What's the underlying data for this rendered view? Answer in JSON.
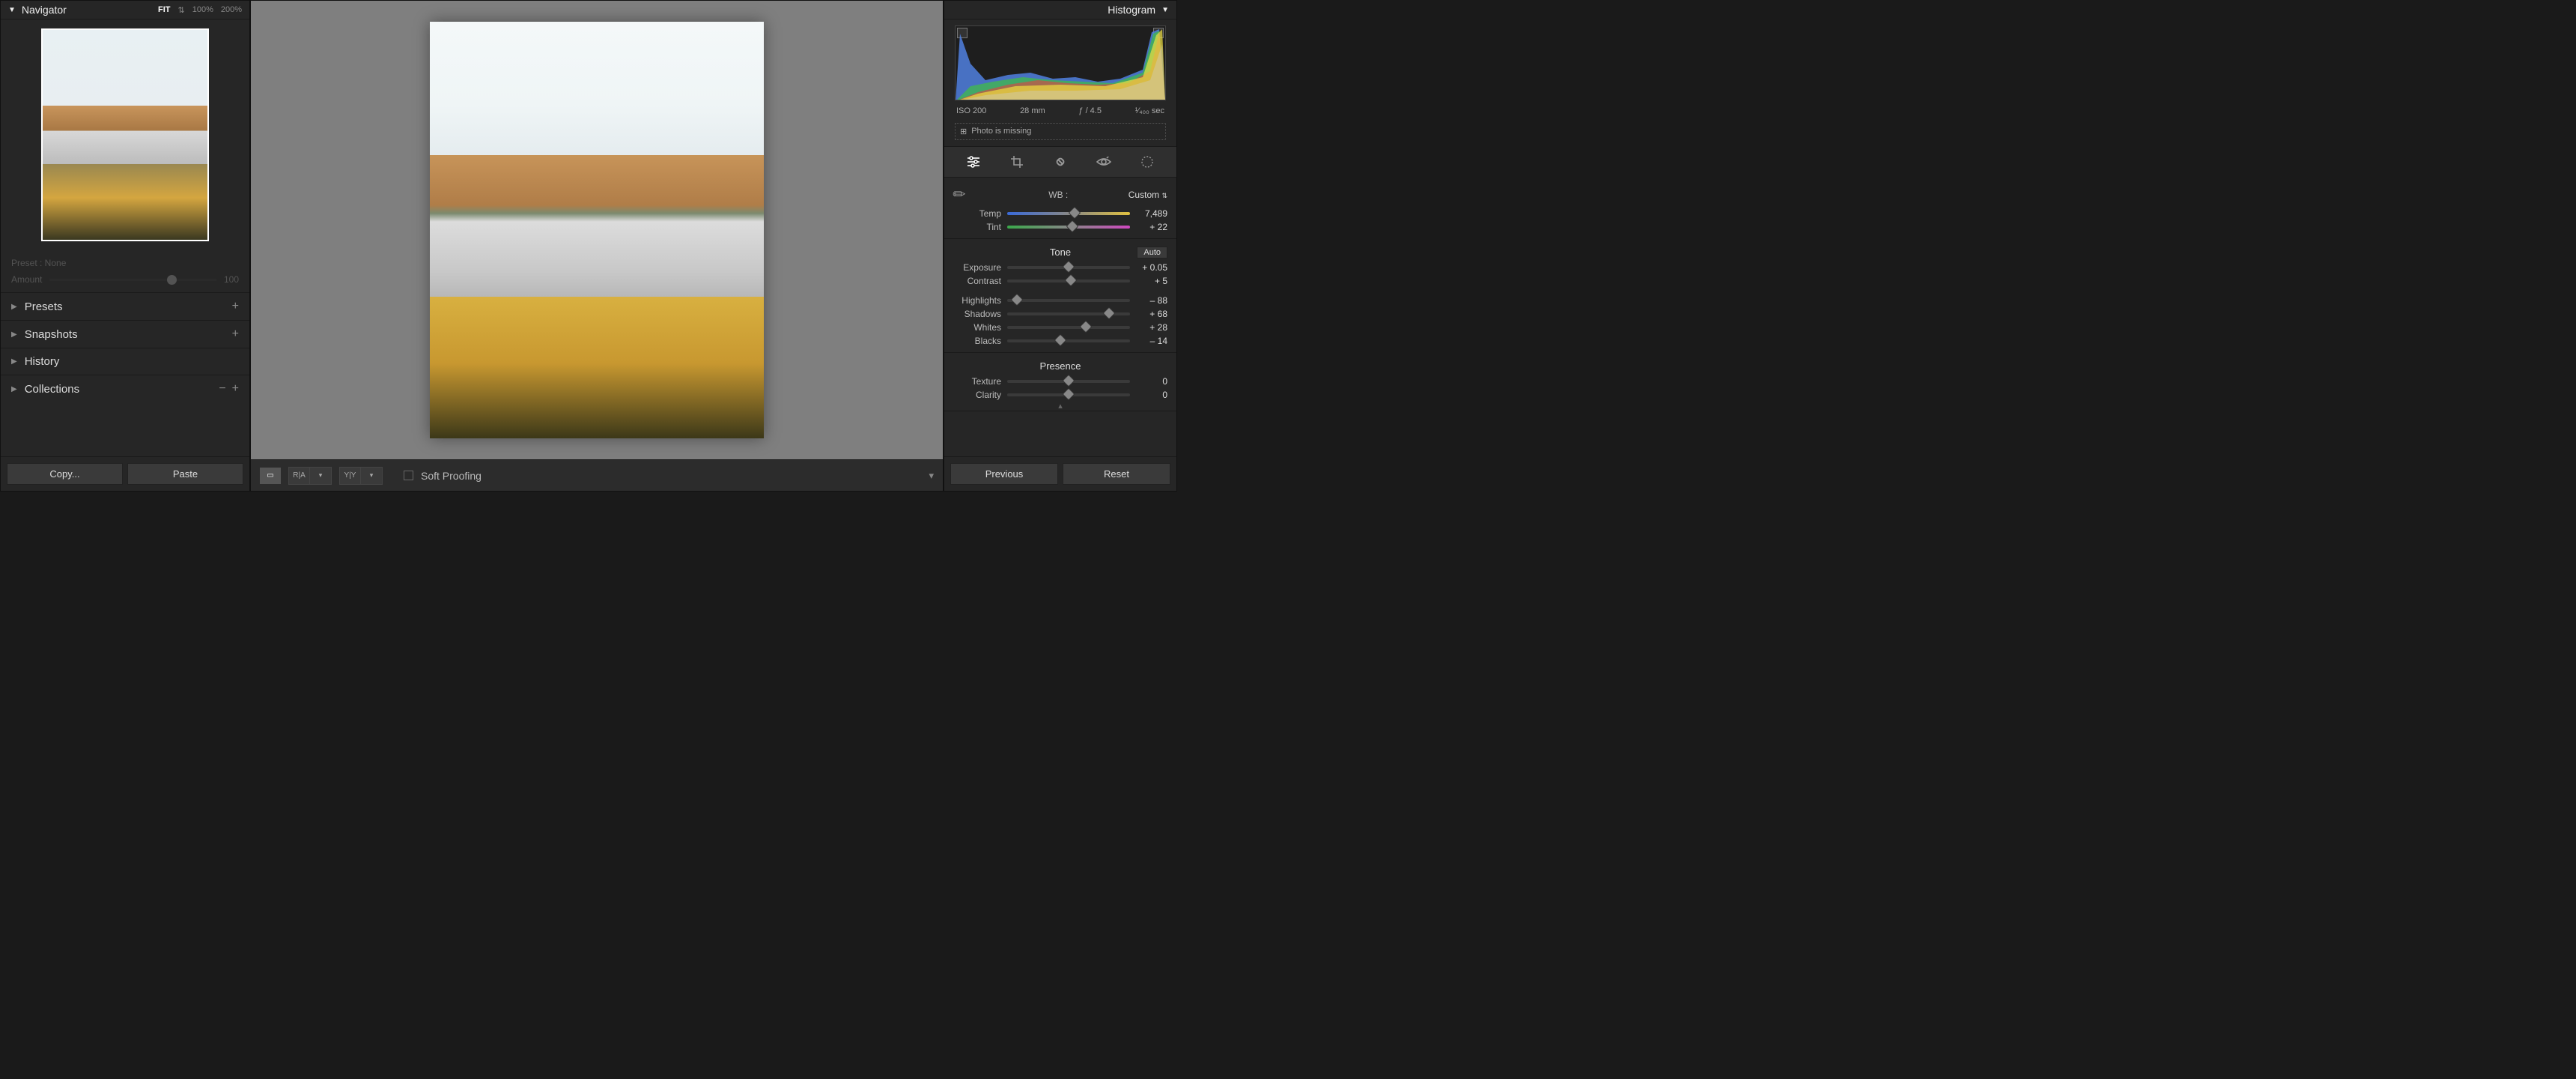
{
  "left": {
    "navigator": "Navigator",
    "zoom": {
      "fit": "FIT",
      "z100": "100%",
      "z200": "200%"
    },
    "preset_label": "Preset : None",
    "amount_label": "Amount",
    "amount_value": "100",
    "accordions": {
      "presets": "Presets",
      "snapshots": "Snapshots",
      "history": "History",
      "collections": "Collections"
    },
    "copy": "Copy...",
    "paste": "Paste"
  },
  "center": {
    "soft_proofing": "Soft Proofing",
    "compare_r": "R|A",
    "compare_y": "Y|Y"
  },
  "right": {
    "histogram": "Histogram",
    "exif": {
      "iso": "ISO 200",
      "focal": "28 mm",
      "aperture": "ƒ / 4.5",
      "shutter": "¹⁄₄₀₀ sec"
    },
    "warning": "Photo is missing",
    "wb_label": "WB :",
    "wb_value": "Custom",
    "sliders": {
      "temp": {
        "label": "Temp",
        "value": "7,489",
        "pos": 55
      },
      "tint": {
        "label": "Tint",
        "value": "+ 22",
        "pos": 53
      },
      "exposure": {
        "label": "Exposure",
        "value": "+ 0.05",
        "pos": 50
      },
      "contrast": {
        "label": "Contrast",
        "value": "+ 5",
        "pos": 52
      },
      "highlights": {
        "label": "Highlights",
        "value": "– 88",
        "pos": 8
      },
      "shadows": {
        "label": "Shadows",
        "value": "+ 68",
        "pos": 83
      },
      "whites": {
        "label": "Whites",
        "value": "+ 28",
        "pos": 64
      },
      "blacks": {
        "label": "Blacks",
        "value": "– 14",
        "pos": 43
      },
      "texture": {
        "label": "Texture",
        "value": "0",
        "pos": 50
      },
      "clarity": {
        "label": "Clarity",
        "value": "0",
        "pos": 50
      }
    },
    "tone": "Tone",
    "auto": "Auto",
    "presence": "Presence",
    "previous": "Previous",
    "reset": "Reset"
  }
}
